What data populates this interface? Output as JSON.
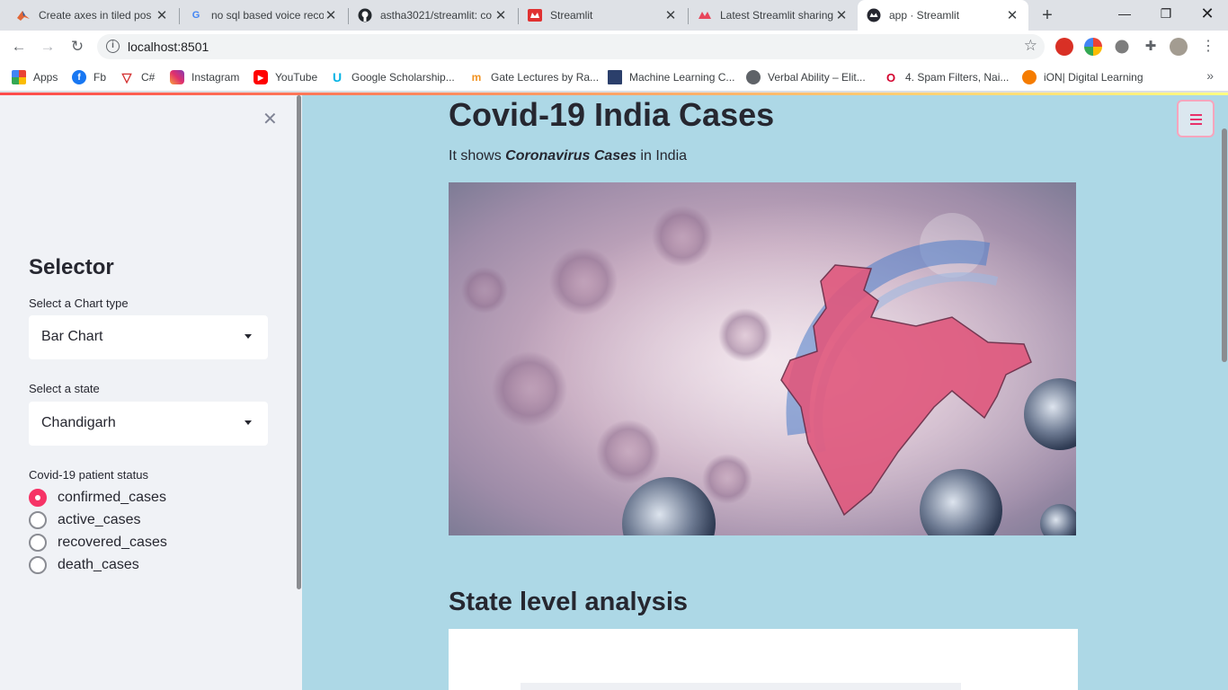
{
  "browser": {
    "tabs": [
      {
        "label": "Create axes in tiled pos",
        "icon": "matlab-icon"
      },
      {
        "label": "no sql based voice reco",
        "icon": "google-icon"
      },
      {
        "label": "astha3021/streamlit: co",
        "icon": "github-icon"
      },
      {
        "label": "Streamlit",
        "icon": "streamlit-icon"
      },
      {
        "label": "Latest Streamlit sharing",
        "icon": "streamlit-icon"
      },
      {
        "label": "app · Streamlit",
        "icon": "streamlit-icon"
      }
    ],
    "active_tab": 5,
    "url": "localhost:8501",
    "bookmarks": [
      {
        "label": "Apps",
        "icon": "apps-grid-icon"
      },
      {
        "label": "Fb",
        "icon": "facebook-icon"
      },
      {
        "label": "C#",
        "icon": "csharp-icon"
      },
      {
        "label": "Instagram",
        "icon": "instagram-icon"
      },
      {
        "label": "YouTube",
        "icon": "youtube-icon"
      },
      {
        "label": "Google Scholarship...",
        "icon": "udacity-icon"
      },
      {
        "label": "Gate Lectures by Ra...",
        "icon": "gate-icon"
      },
      {
        "label": "Machine Learning C...",
        "icon": "bookmark-square-icon"
      },
      {
        "label": "Verbal Ability – Elit...",
        "icon": "globe-icon"
      },
      {
        "label": "4. Spam Filters, Nai...",
        "icon": "oreilly-icon"
      },
      {
        "label": "iON| Digital Learning",
        "icon": "ion-icon"
      }
    ]
  },
  "sidebar": {
    "title": "Selector",
    "chart_type": {
      "label": "Select a Chart type",
      "value": "Bar Chart"
    },
    "state": {
      "label": "Select a state",
      "value": "Chandigarh"
    },
    "status": {
      "label": "Covid-19 patient status",
      "options": [
        "confirmed_cases",
        "active_cases",
        "recovered_cases",
        "death_cases"
      ],
      "selected": 0
    }
  },
  "main": {
    "title": "Covid-19 India Cases",
    "intro_prefix": "It shows ",
    "intro_emphasis": "Coronavirus Cases",
    "intro_suffix": " in India",
    "subheader": "State level analysis"
  },
  "colors": {
    "app_background": "#add8e6",
    "sidebar_background": "#f0f2f6",
    "primary": "#f63366"
  }
}
